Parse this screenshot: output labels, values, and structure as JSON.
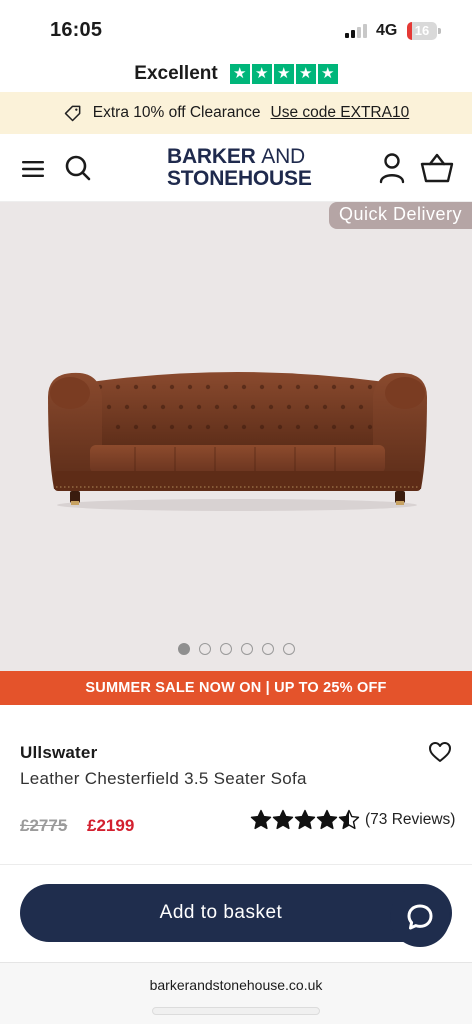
{
  "status_bar": {
    "time": "16:05",
    "network": "4G",
    "battery": "16",
    "battery_level": 0.16
  },
  "trust": {
    "label": "Excellent",
    "stars": 5,
    "star_color": "#00b67a"
  },
  "promo": {
    "text": "Extra 10% off Clearance",
    "code_text": "Use code EXTRA10",
    "icon": "tag-icon"
  },
  "header": {
    "logo_line1_bold": "BARKER",
    "logo_line1_light": "AND",
    "logo_line2": "STONEHOUSE",
    "menu_icon": "menu-icon",
    "search_icon": "search-icon",
    "account_icon": "account-icon",
    "basket_icon": "basket-icon",
    "brand_color": "#1f2a4d"
  },
  "gallery": {
    "badge": "Quick Delivery",
    "image": "brown leather chesterfield sofa",
    "slide_count": 6,
    "active_slide": 1
  },
  "sale_banner": {
    "text": "SUMMER SALE NOW ON | UP TO 25% OFF",
    "color": "#e4532b"
  },
  "product": {
    "name": "Ullswater",
    "description": "Leather Chesterfield 3.5 Seater Sofa",
    "price_old": "£2775",
    "price_new": "£2199",
    "rating": 4.5,
    "reviews": "(73 Reviews)",
    "wishlist_icon": "heart-icon"
  },
  "actions": {
    "add_to_basket": "Add to basket",
    "chat_icon": "chat-icon",
    "button_color": "#1f2d4d"
  },
  "browser": {
    "url": "barkerandstonehouse.co.uk"
  }
}
